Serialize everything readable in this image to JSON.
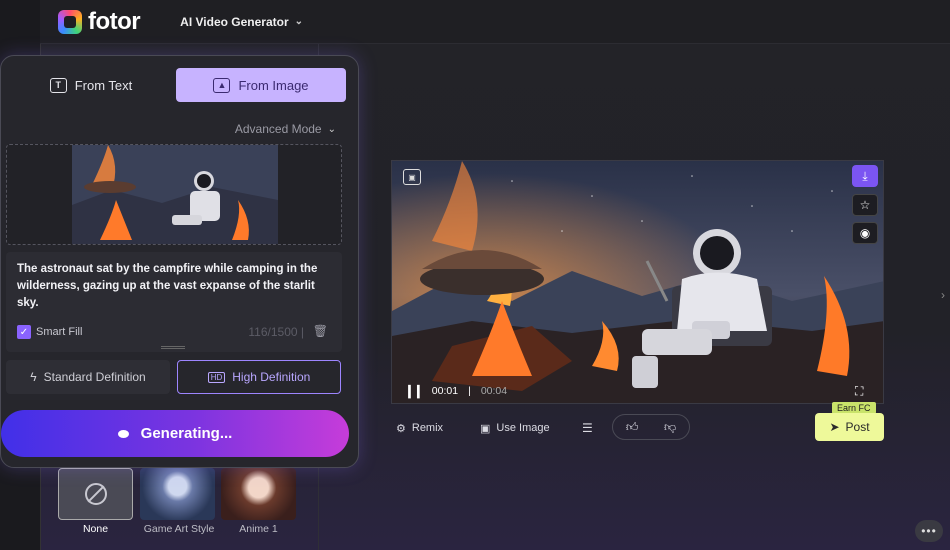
{
  "header": {
    "logo_text": "fotor",
    "tool_name": "AI Video Generator"
  },
  "panel": {
    "tabs": [
      {
        "label": "From Text",
        "icon": "text-icon",
        "active": false
      },
      {
        "label": "From Image",
        "icon": "image-icon",
        "active": true
      }
    ],
    "advanced_mode_label": "Advanced Mode",
    "prompt_text": "The astronaut sat by the campfire while camping in the wilderness, gazing up at the vast expanse of the starlit sky.",
    "smart_fill_label": "Smart Fill",
    "smart_fill_checked": true,
    "char_counter": "116/1500",
    "definition_options": [
      {
        "label": "Standard Definition",
        "selected": false
      },
      {
        "label": "High Definition",
        "selected": true
      }
    ],
    "generate_label": "Generating..."
  },
  "styles": [
    {
      "label": "None",
      "selected": true
    },
    {
      "label": "Game Art Style",
      "selected": false
    },
    {
      "label": "Anime 1",
      "selected": false
    }
  ],
  "player": {
    "current_time": "00:01",
    "separator": "|",
    "total_time": "00:04"
  },
  "actions": {
    "remix_label": "Remix",
    "use_image_label": "Use Image",
    "earn_label": "Earn FC",
    "post_label": "Post"
  },
  "colors": {
    "accent": "#8a63ff",
    "active_tab": "#c7b3ff",
    "post_button": "#eef99a"
  }
}
